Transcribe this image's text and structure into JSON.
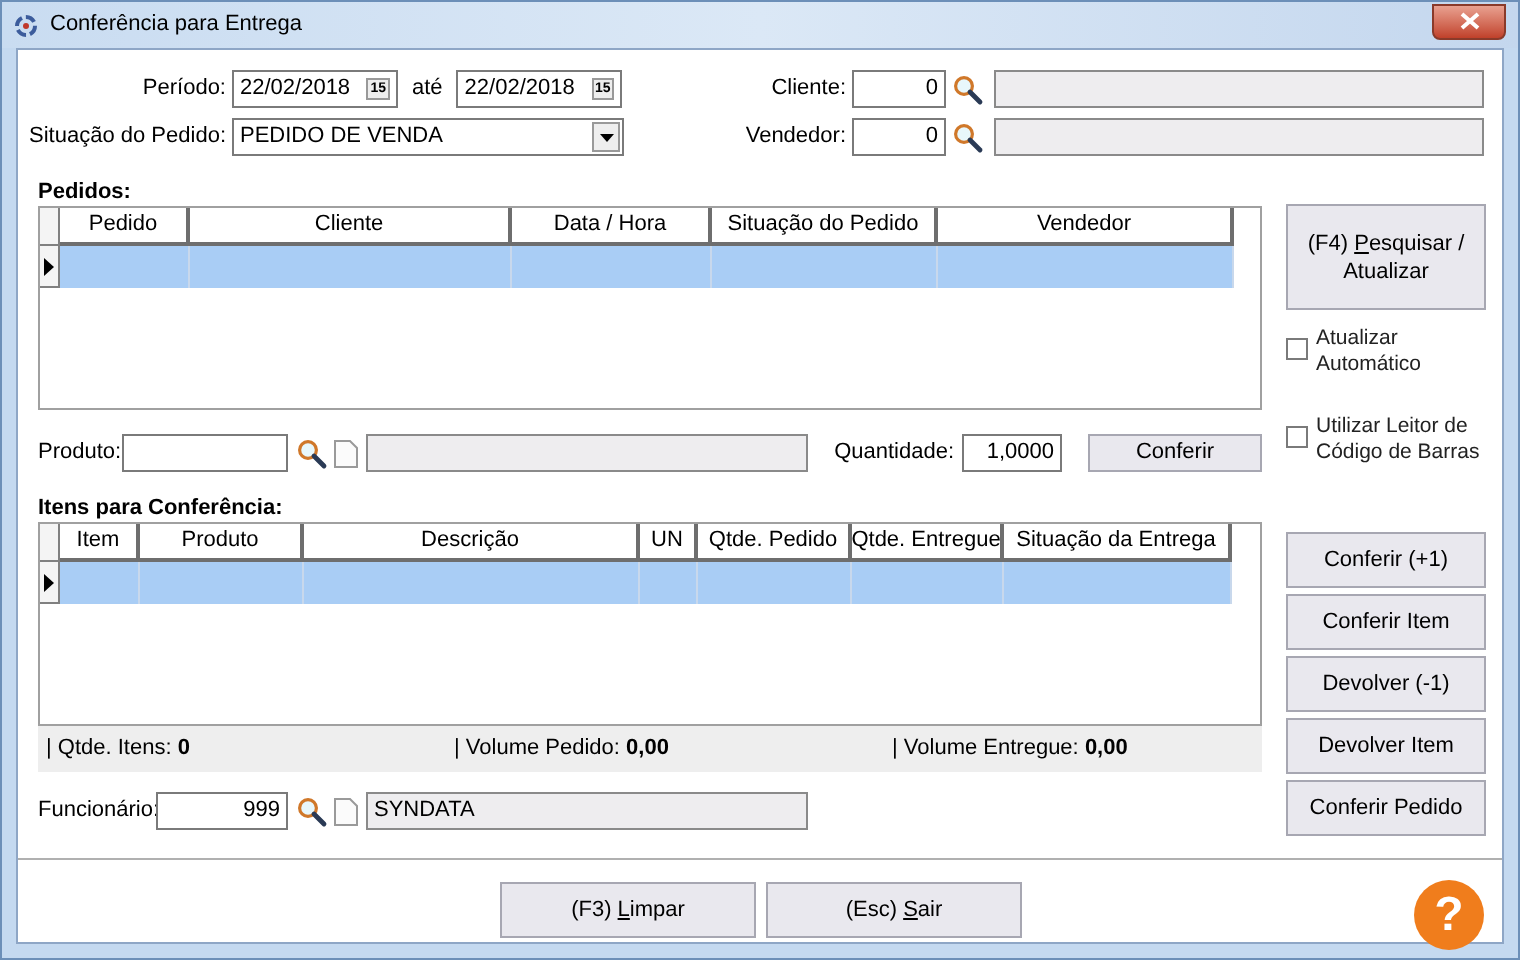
{
  "window": {
    "title": "Conferência para Entrega"
  },
  "filters": {
    "period_label": "Período:",
    "dates": [
      {
        "value": "22/02/2018",
        "calendar": "15"
      },
      {
        "value": "22/02/2018",
        "calendar": "15"
      }
    ],
    "until_label": "até",
    "status_label": "Situação do Pedido:",
    "status_value": "PEDIDO DE VENDA",
    "client_label": "Cliente:",
    "client_code": "0",
    "seller_label": "Vendedor:",
    "seller_code": "0"
  },
  "orders": {
    "title": "Pedidos:",
    "columns": [
      "Pedido",
      "Cliente",
      "Data / Hora",
      "Situação do Pedido",
      "Vendedor"
    ],
    "rows": [
      {
        "selected": true
      }
    ]
  },
  "product": {
    "label": "Produto:",
    "quantity_label": "Quantidade:",
    "quantity": "1,0000",
    "button": "Conferir"
  },
  "search_button": {
    "label_parts": [
      {
        "text": "(F4) ",
        "underline": false
      },
      {
        "text": "P",
        "underline": true
      },
      {
        "text": "esquisar / Atualizar",
        "underline": false
      }
    ]
  },
  "checkboxes": [
    {
      "label": "Atualizar Automático",
      "checked": false
    },
    {
      "label": "Utilizar Leitor de Código de Barras",
      "checked": false
    }
  ],
  "items": {
    "title": "Itens para Conferência:",
    "columns": [
      "Item",
      "Produto",
      "Descrição",
      "UN",
      "Qtde. Pedido",
      "Qtde. Entregue",
      "Situação da Entrega"
    ],
    "rows": [
      {
        "selected": true
      }
    ]
  },
  "summary": [
    {
      "label": "| Qtde. Itens:",
      "value": "0"
    },
    {
      "label": "| Volume Pedido:",
      "value": "0,00"
    },
    {
      "label": "| Volume Entregue:",
      "value": "0,00"
    }
  ],
  "item_buttons": [
    "Conferir (+1)",
    "Conferir Item",
    "Devolver (-1)",
    "Devolver Item",
    "Conferir Pedido"
  ],
  "employee": {
    "label": "Funcionário:",
    "code": "999",
    "name": "SYNDATA"
  },
  "footer_buttons": [
    {
      "label_parts": [
        {
          "text": "(F3) ",
          "underline": false
        },
        {
          "text": "L",
          "underline": true
        },
        {
          "text": "impar",
          "underline": false
        }
      ]
    },
    {
      "label_parts": [
        {
          "text": "(Esc) ",
          "underline": false
        },
        {
          "text": "S",
          "underline": true
        },
        {
          "text": "air",
          "underline": false
        }
      ]
    }
  ],
  "help": "?"
}
